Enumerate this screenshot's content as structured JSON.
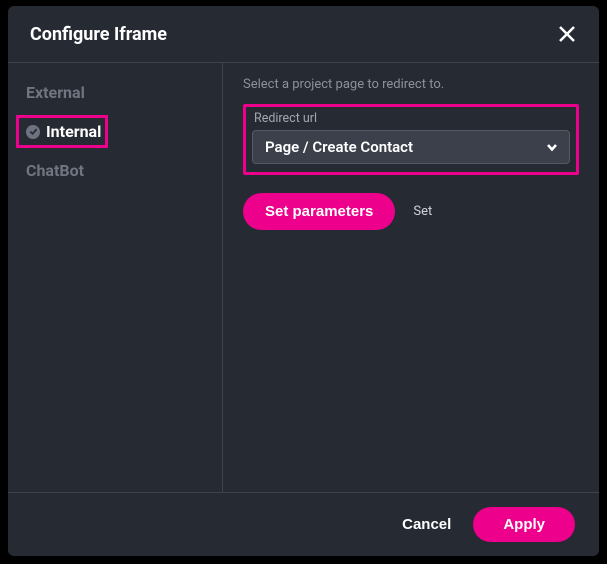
{
  "modal": {
    "title": "Configure Iframe"
  },
  "sidebar": {
    "items": [
      {
        "label": "External",
        "selected": false
      },
      {
        "label": "Internal",
        "selected": true
      },
      {
        "label": "ChatBot",
        "selected": false
      }
    ]
  },
  "main": {
    "hint": "Select a project page to redirect to.",
    "redirect_field": {
      "label": "Redirect url",
      "value": "Page / Create Contact"
    },
    "set_parameters_btn": "Set parameters",
    "set_label": "Set"
  },
  "footer": {
    "cancel": "Cancel",
    "apply": "Apply"
  }
}
